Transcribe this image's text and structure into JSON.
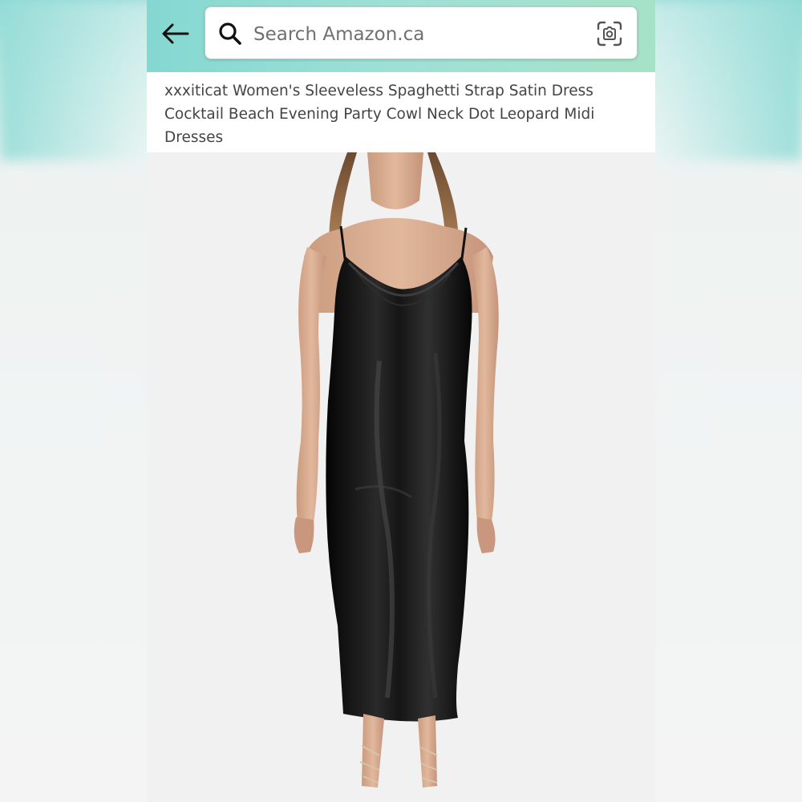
{
  "header": {
    "back_icon": "arrow-left-icon",
    "search": {
      "placeholder": "Search Amazon.ca",
      "value": "",
      "search_icon": "magnifier-icon",
      "camera_icon": "camera-lens-icon"
    }
  },
  "product": {
    "title": "xxxiticat Women's Sleeveless Spaghetti Strap Satin Dress Cocktail Beach Evening Party Cowl Neck Dot Leopard Midi Dresses",
    "image_subject": "model-in-black-satin-cowl-neck-midi-dress"
  },
  "colors": {
    "header_teal": "#84d8d1",
    "dress_black": "#111111",
    "title_text": "#444444"
  }
}
